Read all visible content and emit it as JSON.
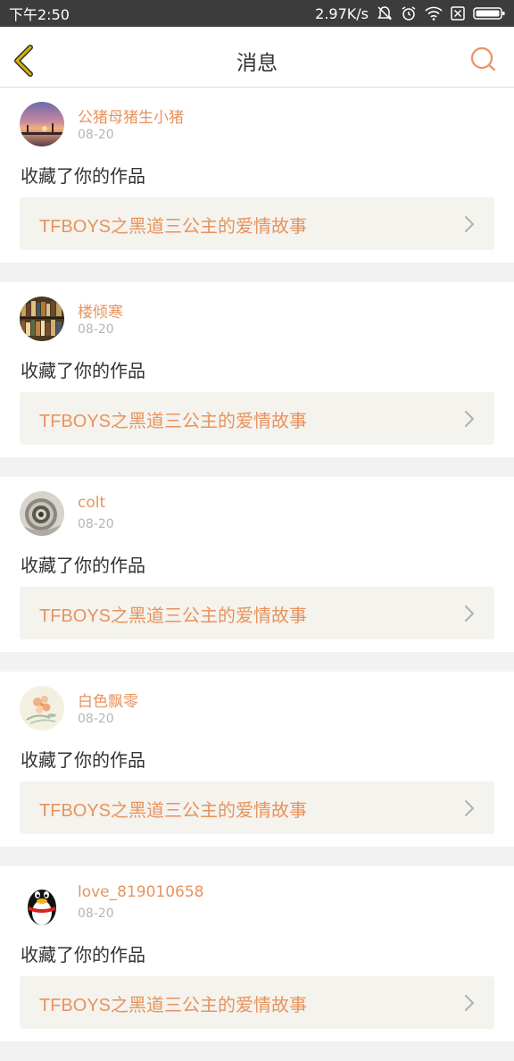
{
  "status_bar": {
    "time": "下午2:50",
    "speed": "2.97K/s",
    "icons": [
      "bell-off-icon",
      "alarm-icon",
      "wifi-icon",
      "sim-off-icon",
      "battery-icon"
    ]
  },
  "header": {
    "title": "消息",
    "back_icon": "chevron-left-icon",
    "search_icon": "search-icon"
  },
  "colors": {
    "accent": "#e8935e",
    "back_icon": "#d9b400",
    "status_bar_bg": "#3c3c3c",
    "link_bg": "#f4f3ee"
  },
  "messages": [
    {
      "username": "公猪母猪生小猪",
      "date": "08-20",
      "action": "收藏了你的作品",
      "work_title": "TFBOYS之黑道三公主的爱情故事",
      "avatar": "sunset-photo"
    },
    {
      "username": "楼倾寒",
      "date": "08-20",
      "action": "收藏了你的作品",
      "work_title": "TFBOYS之黑道三公主的爱情故事",
      "avatar": "bookshelf-photo"
    },
    {
      "username": "colt",
      "date": "08-20",
      "action": "收藏了你的作品",
      "work_title": "TFBOYS之黑道三公主的爱情故事",
      "avatar": "spiral-photo"
    },
    {
      "username": "白色飘零",
      "date": "08-20",
      "action": "收藏了你的作品",
      "work_title": "TFBOYS之黑道三公主的爱情故事",
      "avatar": "flower-painting"
    },
    {
      "username": "love_819010658",
      "date": "08-20",
      "action": "收藏了你的作品",
      "work_title": "TFBOYS之黑道三公主的爱情故事",
      "avatar": "penguin-icon"
    }
  ]
}
